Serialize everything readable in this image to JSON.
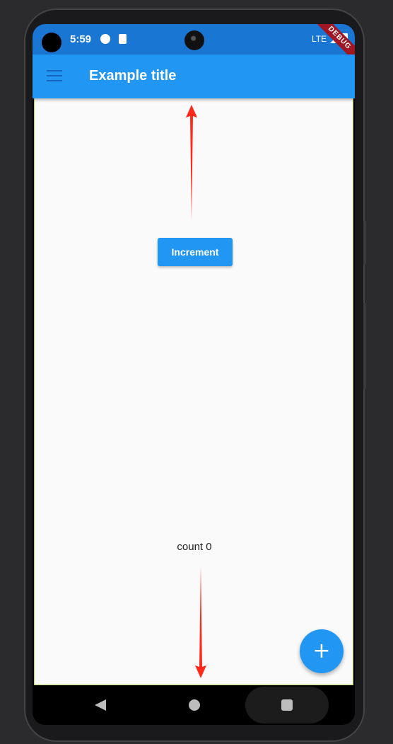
{
  "status_bar": {
    "time": "5:59",
    "network": "LTE",
    "debug_banner": "DEBUG"
  },
  "app_bar": {
    "title": "Example title",
    "menu_icon": "menu-icon"
  },
  "main": {
    "increment_label": "Increment",
    "count_label": "count 0",
    "fab_symbol": "+"
  },
  "colors": {
    "primary": "#2196f3",
    "status_bar": "#1976d2",
    "annotation_arrow": "#ff2a1a",
    "debug_banner": "#a01622"
  },
  "nav_bar": {
    "icons": [
      "back-icon",
      "home-icon",
      "recents-icon"
    ]
  }
}
